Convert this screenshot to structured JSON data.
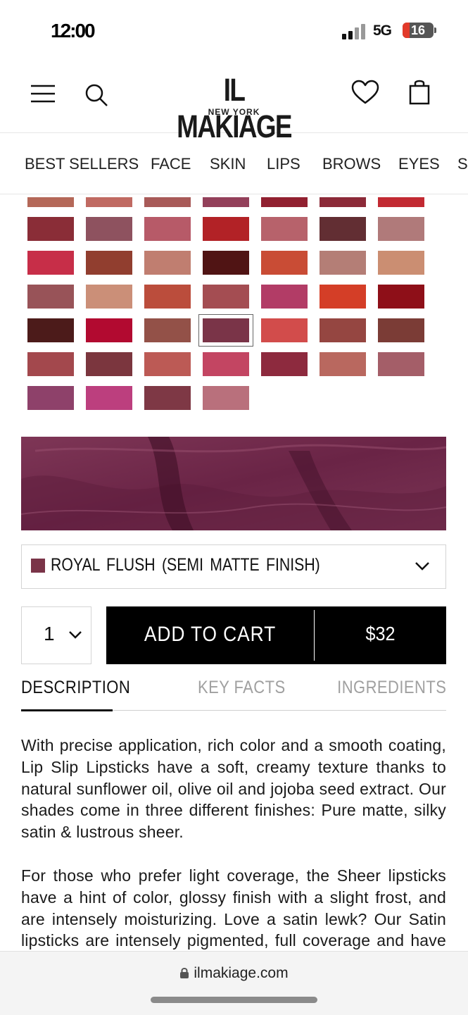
{
  "status_bar": {
    "time": "12:00",
    "network": "5G",
    "battery": "16"
  },
  "header": {
    "brand": "IL MAKIAGE",
    "brand_sub": "NEW YORK",
    "menu_icon": "menu-icon",
    "search_icon": "search-icon",
    "wishlist_icon": "heart-icon",
    "bag_icon": "shopping-bag-icon"
  },
  "nav": {
    "items": [
      "BEST SELLERS",
      "FACE",
      "SKIN",
      "LIPS",
      "BROWS",
      "EYES",
      "S"
    ]
  },
  "swatches": {
    "colors": [
      "#b46858",
      "#c06a62",
      "#a85a58",
      "#93405a",
      "#912030",
      "#8c2a38",
      "#c22a32",
      "#8a2d37",
      "#8e525f",
      "#b75a68",
      "#b22226",
      "#b7626b",
      "#622e33",
      "#b07a7a",
      "#c72e48",
      "#913e2f",
      "#c07e70",
      "#501414",
      "#c94c35",
      "#b47e76",
      "#cb8e72",
      "#985358",
      "#cb8f78",
      "#bb4d3c",
      "#a44d52",
      "#b23c66",
      "#d43e27",
      "#8e0f18",
      "#4c1b1a",
      "#b20a30",
      "#935148",
      "#7a3448",
      "#d24c4b",
      "#954641",
      "#7b3c36",
      "#a3484d",
      "#7b363e",
      "#bc5a55",
      "#c34562",
      "#8d2a3e",
      "#b9685f",
      "#a45e68",
      "#8e416a",
      "#bc3f7e",
      "#7e3845",
      "#b9707c"
    ],
    "selected_index": 31
  },
  "shade": {
    "name": "ROYAL FLUSH (SEMI MATTE FINISH)",
    "color": "#7a3448"
  },
  "quantity": "1",
  "cart": {
    "label": "ADD TO CART",
    "price": "$32"
  },
  "tabs": [
    {
      "label": "DESCRIPTION",
      "active": true
    },
    {
      "label": "KEY FACTS",
      "active": false
    },
    {
      "label": "INGREDIENTS",
      "active": false
    }
  ],
  "description": [
    "With precise application, rich color and a smooth coating, Lip Slip Lipsticks have a soft, creamy texture thanks to natural sunflower oil, olive oil and jojoba seed extract. Our shades come in three different finishes: Pure matte, silky satin & lustrous sheer.",
    "For those who prefer light coverage, the Sheer lipsticks have a hint of color, glossy finish with a slight frost, and are intensely moisturizing. Love a satin lewk? Our Satin lipsticks are intensely pigmented, full coverage and have a"
  ],
  "browser": {
    "url": "ilmakiage.com"
  },
  "colors": {
    "accent": "#000000",
    "shade_chip": "#7a3448",
    "texture": "#6e2a4a"
  }
}
